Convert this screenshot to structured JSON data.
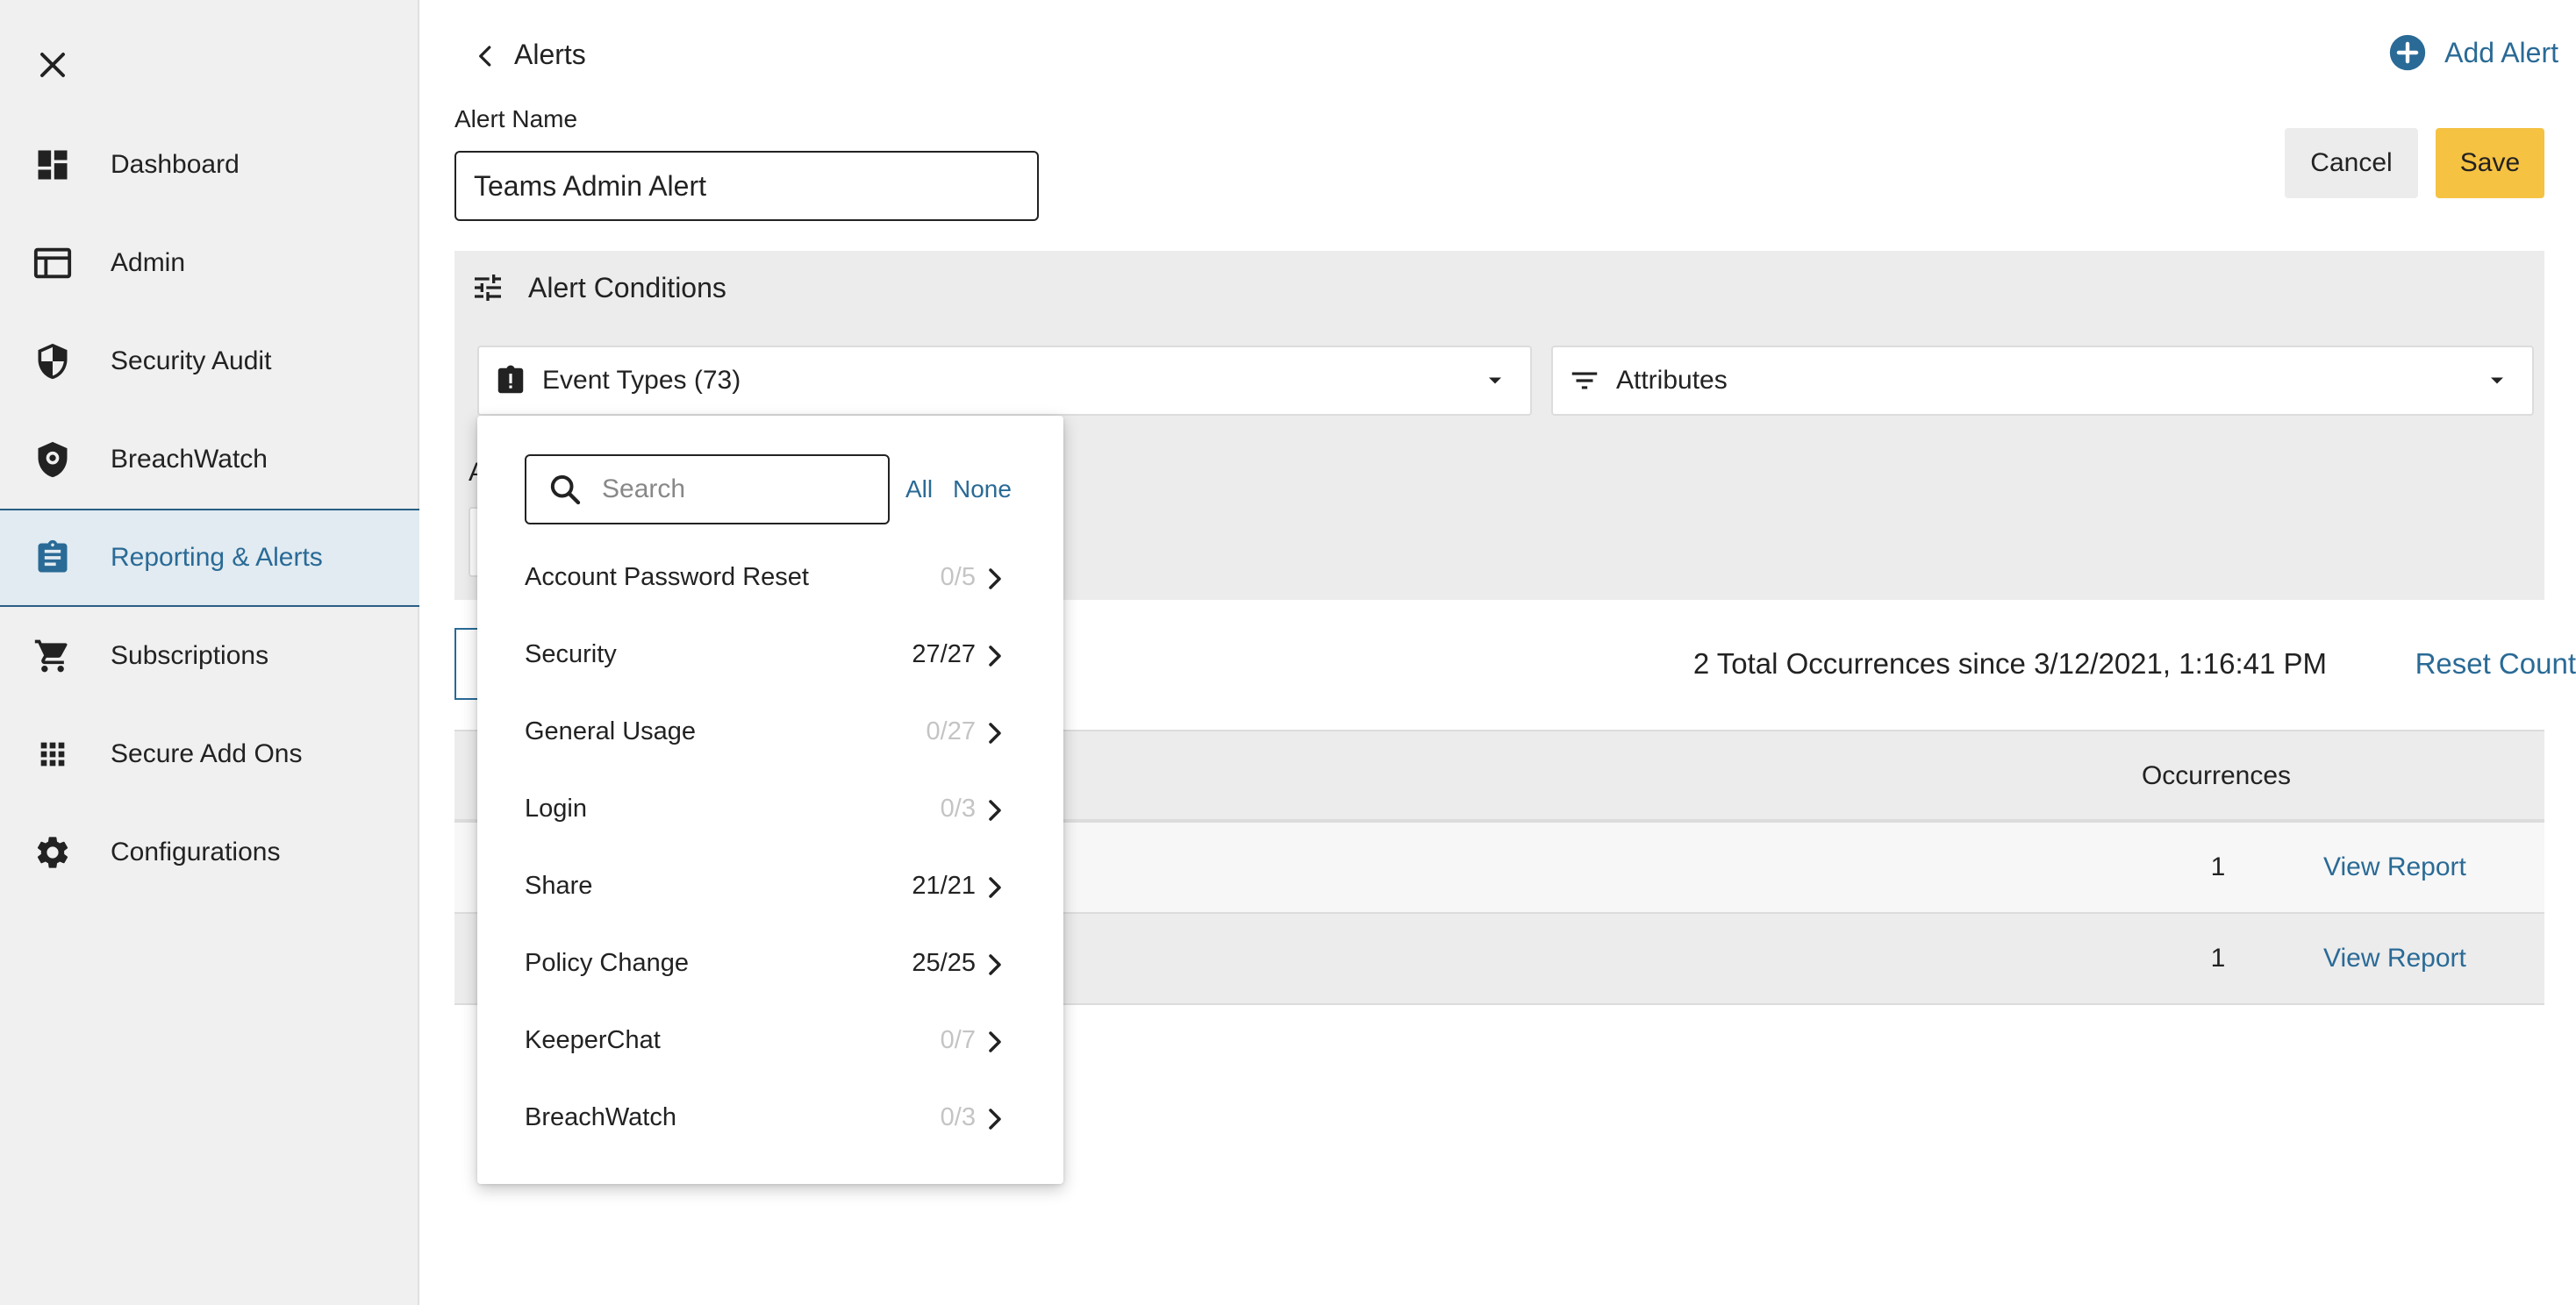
{
  "sidebar": {
    "items": [
      {
        "label": "Dashboard",
        "icon": "dashboard-icon",
        "active": false
      },
      {
        "label": "Admin",
        "icon": "admin-icon",
        "active": false
      },
      {
        "label": "Security Audit",
        "icon": "shield-icon",
        "active": false
      },
      {
        "label": "BreachWatch",
        "icon": "breachwatch-icon",
        "active": false
      },
      {
        "label": "Reporting & Alerts",
        "icon": "clipboard-icon",
        "active": true
      },
      {
        "label": "Subscriptions",
        "icon": "cart-icon",
        "active": false
      },
      {
        "label": "Secure Add Ons",
        "icon": "grid-icon",
        "active": false
      },
      {
        "label": "Configurations",
        "icon": "gear-icon",
        "active": false
      }
    ]
  },
  "header": {
    "title": "Alerts",
    "add_label": "Add Alert"
  },
  "form": {
    "name_label": "Alert Name",
    "name_value": "Teams Admin Alert",
    "cancel_label": "Cancel",
    "save_label": "Save"
  },
  "conditions": {
    "title": "Alert Conditions",
    "event_types_label": "Event Types (73)",
    "attributes_label": "Attributes",
    "partial_letter": "A"
  },
  "occurrences": {
    "summary": "2 Total Occurrences since 3/12/2021, 1:16:41 PM",
    "reset_label": "Reset Count",
    "column_header": "Occurrences",
    "rows": [
      {
        "count": "1",
        "link": "View Report"
      },
      {
        "count": "1",
        "link": "View Report"
      }
    ]
  },
  "dropdown": {
    "search_placeholder": "Search",
    "all_label": "All",
    "none_label": "None",
    "items": [
      {
        "label": "Account Password Reset",
        "count": "0/5",
        "zero": true
      },
      {
        "label": "Security",
        "count": "27/27",
        "zero": false
      },
      {
        "label": "General Usage",
        "count": "0/27",
        "zero": true
      },
      {
        "label": "Login",
        "count": "0/3",
        "zero": true
      },
      {
        "label": "Share",
        "count": "21/21",
        "zero": false
      },
      {
        "label": "Policy Change",
        "count": "25/25",
        "zero": false
      },
      {
        "label": "KeeperChat",
        "count": "0/7",
        "zero": true
      },
      {
        "label": "BreachWatch",
        "count": "0/3",
        "zero": true
      }
    ]
  },
  "colors": {
    "accent": "#2a6a96",
    "save": "#f5c242",
    "sidebar_bg": "#f0f0f0",
    "active_bg": "#e1ebf1"
  }
}
